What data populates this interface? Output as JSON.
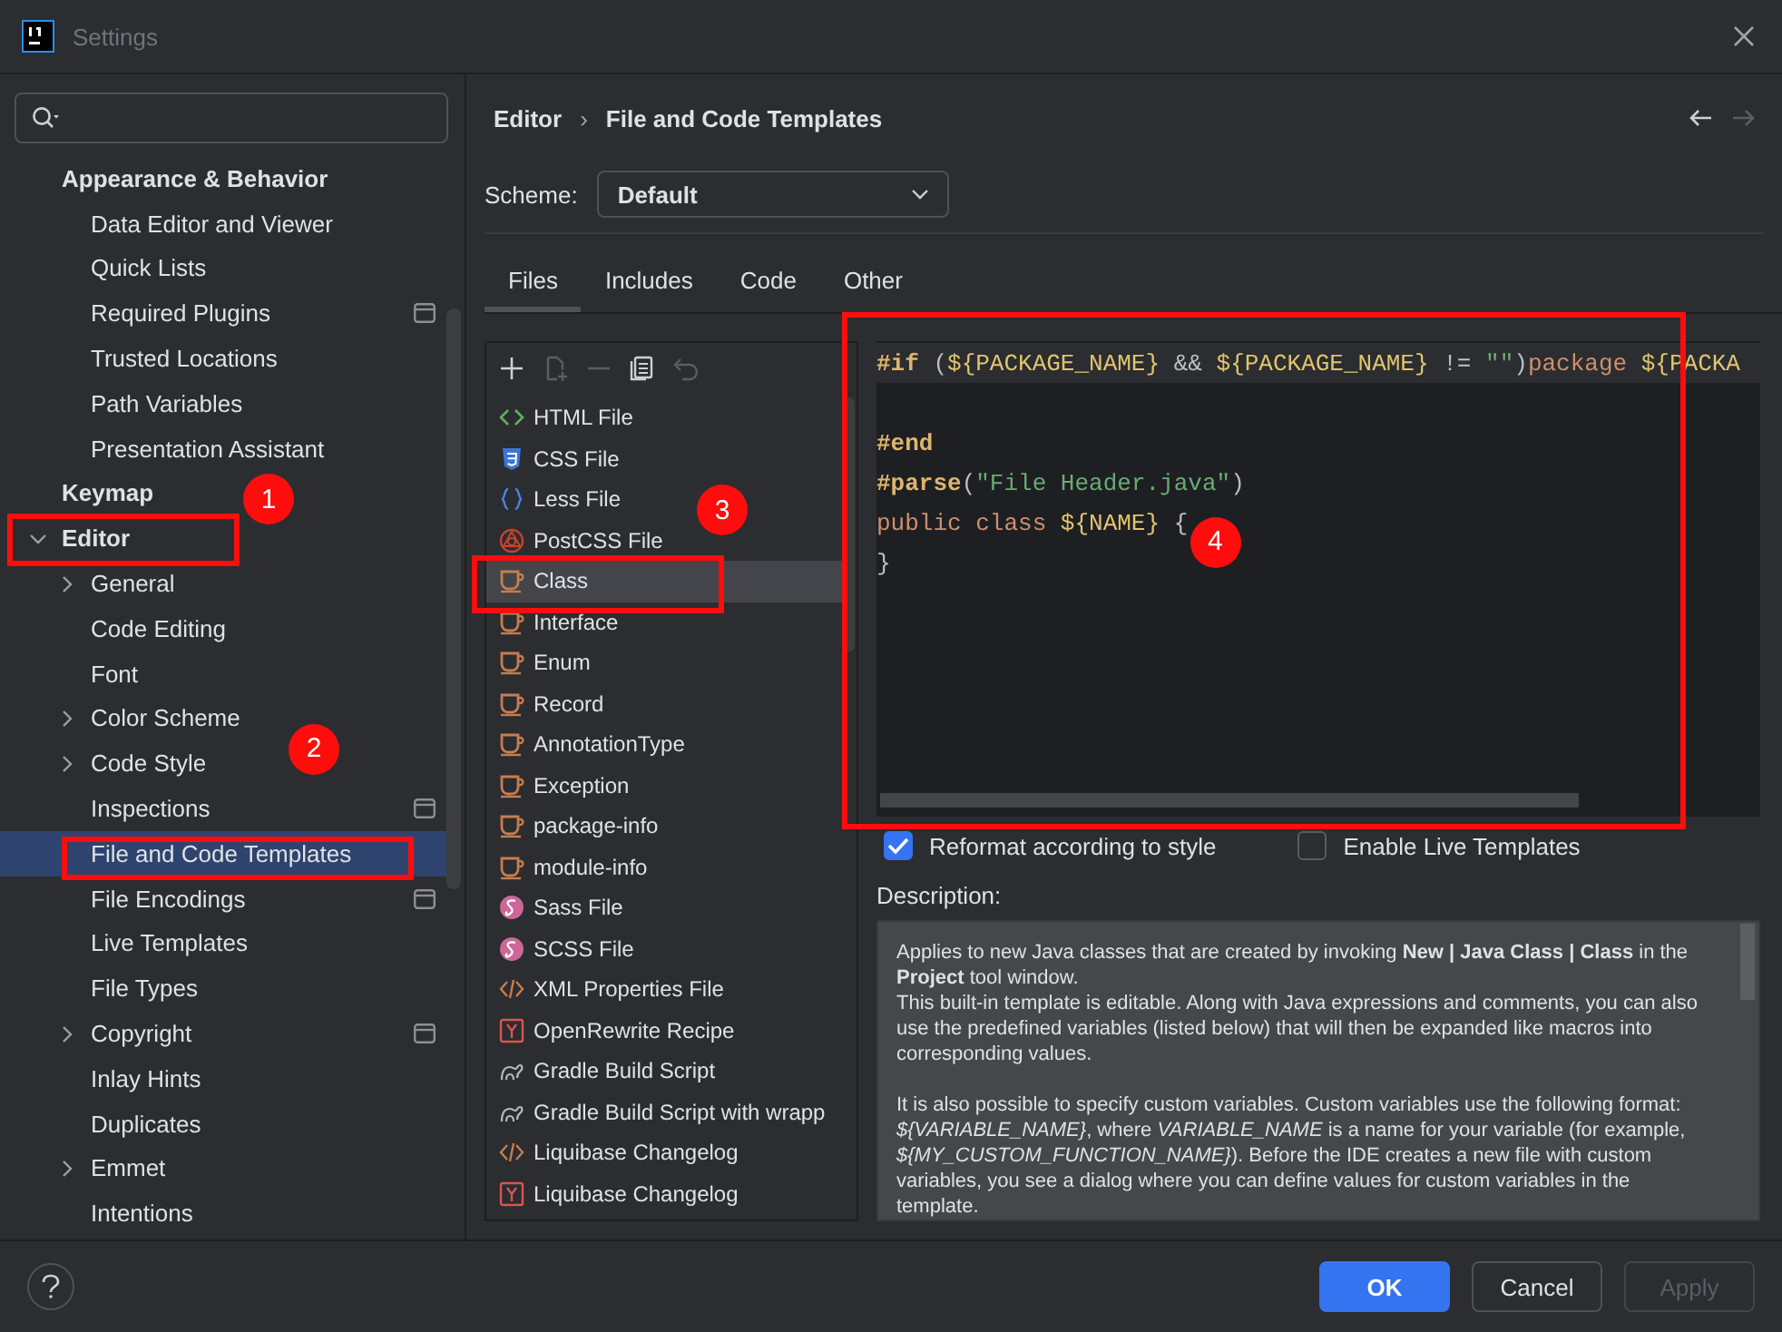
{
  "window": {
    "title": "Settings"
  },
  "sidebar": {
    "items": [
      {
        "label": "Appearance & Behavior",
        "children": [
          {
            "label": "Data Editor and Viewer",
            "selected": false
          },
          {
            "label": "Quick Lists",
            "selected": false
          },
          {
            "label": "Required Plugins",
            "selected": false,
            "project_scoped": true
          },
          {
            "label": "Trusted Locations",
            "selected": false
          },
          {
            "label": "Path Variables",
            "selected": false
          },
          {
            "label": "Presentation Assistant",
            "selected": false
          }
        ],
        "selected": false
      },
      {
        "label": "Keymap",
        "selected": false
      },
      {
        "label": "Editor",
        "expanded": true,
        "selected": false,
        "children": [
          {
            "label": "General",
            "expanded": false,
            "selected": false
          },
          {
            "label": "Code Editing",
            "selected": false
          },
          {
            "label": "Font",
            "selected": false
          },
          {
            "label": "Color Scheme",
            "expanded": false,
            "selected": false
          },
          {
            "label": "Code Style",
            "expanded": false,
            "selected": false
          },
          {
            "label": "Inspections",
            "selected": false,
            "project_scoped": true
          },
          {
            "label": "File and Code Templates",
            "selected": true
          },
          {
            "label": "File Encodings",
            "selected": false,
            "project_scoped": true
          },
          {
            "label": "Live Templates",
            "selected": false
          },
          {
            "label": "File Types",
            "selected": false
          },
          {
            "label": "Copyright",
            "expanded": false,
            "selected": false,
            "project_scoped": true
          },
          {
            "label": "Inlay Hints",
            "selected": false
          },
          {
            "label": "Duplicates",
            "selected": false
          },
          {
            "label": "Emmet",
            "expanded": false,
            "selected": false
          },
          {
            "label": "Intentions",
            "selected": false
          }
        ]
      }
    ]
  },
  "breadcrumb": [
    "Editor",
    "File and Code Templates"
  ],
  "breadcrumb_separator": "›",
  "nav": [
    {
      "kind": "back",
      "disabled": false
    },
    {
      "kind": "forward",
      "disabled": true
    }
  ],
  "scheme": {
    "label": "Scheme:",
    "value": "Default"
  },
  "tabs": [
    {
      "label": "Files",
      "selected": true
    },
    {
      "label": "Includes",
      "selected": false
    },
    {
      "label": "Code",
      "selected": false
    },
    {
      "label": "Other",
      "selected": false
    }
  ],
  "toolbar": [
    {
      "kind": "add",
      "disabled": false
    },
    {
      "kind": "add-copy",
      "disabled": true
    },
    {
      "kind": "remove",
      "disabled": true
    },
    {
      "kind": "copy",
      "disabled": false
    },
    {
      "kind": "reset",
      "disabled": true
    }
  ],
  "templates": [
    {
      "label": "HTML File",
      "kind": "html",
      "selected": false
    },
    {
      "label": "CSS File",
      "kind": "css",
      "selected": false
    },
    {
      "label": "Less File",
      "kind": "less",
      "selected": false
    },
    {
      "label": "PostCSS File",
      "kind": "postcss",
      "selected": false
    },
    {
      "label": "Class",
      "kind": "java",
      "selected": true
    },
    {
      "label": "Interface",
      "kind": "java",
      "selected": false
    },
    {
      "label": "Enum",
      "kind": "java",
      "selected": false
    },
    {
      "label": "Record",
      "kind": "java",
      "selected": false
    },
    {
      "label": "AnnotationType",
      "kind": "java",
      "selected": false
    },
    {
      "label": "Exception",
      "kind": "java",
      "selected": false
    },
    {
      "label": "package-info",
      "kind": "java",
      "selected": false
    },
    {
      "label": "module-info",
      "kind": "java",
      "selected": false
    },
    {
      "label": "Sass File",
      "kind": "sass",
      "selected": false
    },
    {
      "label": "SCSS File",
      "kind": "sass",
      "selected": false
    },
    {
      "label": "XML Properties File",
      "kind": "xml",
      "selected": false
    },
    {
      "label": "OpenRewrite Recipe",
      "kind": "yaml",
      "selected": false
    },
    {
      "label": "Gradle Build Script",
      "kind": "gradle",
      "selected": false
    },
    {
      "label": "Gradle Build Script with wrapp",
      "kind": "gradle",
      "selected": false
    },
    {
      "label": "Liquibase Changelog",
      "kind": "xml",
      "selected": false
    },
    {
      "label": "Liquibase Changelog",
      "kind": "yaml",
      "selected": false
    }
  ],
  "code": [
    {
      "tokens": [
        {
          "kind": "directive",
          "text": "#if"
        },
        {
          "kind": "plain",
          "text": " ("
        },
        {
          "kind": "var",
          "text": "${PACKAGE_NAME}"
        },
        {
          "kind": "plain",
          "text": " && "
        },
        {
          "kind": "var",
          "text": "${PACKAGE_NAME}"
        },
        {
          "kind": "plain",
          "text": " != "
        },
        {
          "kind": "string",
          "text": "\"\""
        },
        {
          "kind": "plain",
          "text": ")"
        },
        {
          "kind": "keyword",
          "text": "package "
        },
        {
          "kind": "var",
          "text": "${PACKA"
        }
      ]
    },
    {
      "blank": true
    },
    {
      "tokens": [
        {
          "kind": "directive",
          "text": "#end"
        }
      ]
    },
    {
      "tokens": [
        {
          "kind": "directive",
          "text": "#parse"
        },
        {
          "kind": "plain",
          "text": "("
        },
        {
          "kind": "string",
          "text": "\"File Header.java\""
        },
        {
          "kind": "plain",
          "text": ")"
        }
      ]
    },
    {
      "tokens": [
        {
          "kind": "keyword",
          "text": "public class "
        },
        {
          "kind": "var",
          "text": "${NAME}"
        },
        {
          "kind": "plain",
          "text": " {"
        }
      ]
    },
    {
      "tokens": [
        {
          "kind": "plain",
          "text": "}"
        }
      ]
    }
  ],
  "options": [
    {
      "label": "Reformat according to style",
      "checked": true
    },
    {
      "label": "Enable Live Templates",
      "checked": false
    }
  ],
  "description": {
    "label": "Description:",
    "paragraphs": [
      {
        "text": "Applies to new Java classes that are created by invoking **New | Java Class | Class** in the **Project** tool window.",
        "gap": false
      },
      {
        "text": "This built-in template is editable. Along with Java expressions and comments, you can also use the predefined variables (listed below) that will then be expanded like macros into corresponding values.",
        "gap": false
      },
      {
        "text": "It is also possible to specify custom variables. Custom variables use the following format: *${VARIABLE_NAME}*, where *VARIABLE_NAME* is a name for your variable (for example, *${MY_CUSTOM_FUNCTION_NAME}*). Before the IDE creates a new file with custom variables, you see a dialog where you can define values for custom variables in the template.",
        "gap": true
      }
    ]
  },
  "buttons": [
    {
      "label": "OK",
      "kind": "primary",
      "disabled": false
    },
    {
      "label": "Cancel",
      "kind": "normal",
      "disabled": false
    },
    {
      "label": "Apply",
      "kind": "normal",
      "disabled": true
    }
  ],
  "annotations": [
    {
      "number": "1"
    },
    {
      "number": "2"
    },
    {
      "number": "3"
    },
    {
      "number": "4"
    }
  ]
}
